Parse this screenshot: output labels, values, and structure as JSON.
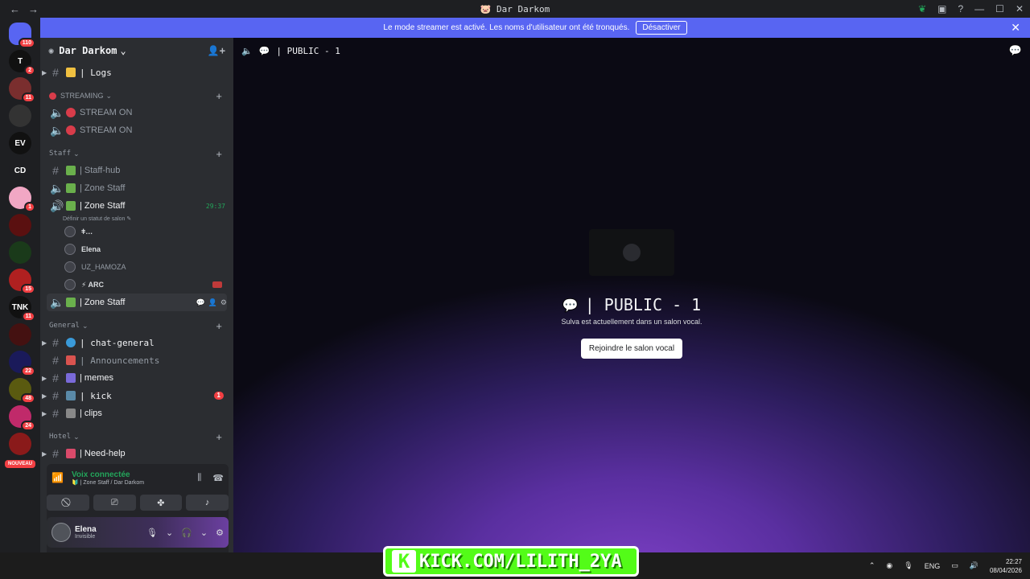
{
  "window": {
    "title": "🐷 Dar Darkom",
    "back": "←",
    "forward": "→"
  },
  "banner": {
    "text": "Le mode streamer est activé. Les noms d'utilisateur ont été tronqués.",
    "button": "Désactiver",
    "close": "✕"
  },
  "guilds": [
    {
      "label": "110",
      "color": "#5865f2",
      "badge": "110",
      "kind": "home"
    },
    {
      "label": "T",
      "color": "#111",
      "badge": "2"
    },
    {
      "label": "",
      "color": "#7a2e2e",
      "badge": "11"
    },
    {
      "label": "",
      "color": "#333",
      "badge": ""
    },
    {
      "label": "EV",
      "color": "#111",
      "badge": ""
    },
    {
      "label": "CD",
      "color": "#1e1f22",
      "badge": ""
    },
    {
      "label": "",
      "color": "#f1a7c4",
      "badge": "1"
    },
    {
      "label": "",
      "color": "#5a1010",
      "badge": ""
    },
    {
      "label": "",
      "color": "#1a3a1a",
      "badge": ""
    },
    {
      "label": "",
      "color": "#b02020",
      "badge": "15"
    },
    {
      "label": "TNK",
      "color": "#111",
      "badge": "11"
    },
    {
      "label": "",
      "color": "#441111",
      "badge": ""
    },
    {
      "label": "",
      "color": "#1a1a5a",
      "badge": "22"
    },
    {
      "label": "",
      "color": "#5a5a10",
      "badge": "48"
    },
    {
      "label": "",
      "color": "#c02a6a",
      "badge": "24"
    },
    {
      "label": "",
      "color": "#8a1a1a",
      "badge": ""
    }
  ],
  "new_badge": "NOUVEAU",
  "server": {
    "name": "Dar Darkom",
    "chevron": "⌄"
  },
  "channels": {
    "logs": "| Logs",
    "streaming_cat": "STREAMING",
    "stream1": "STREAM ON",
    "stream2": "STREAM ON",
    "staff_cat": "Staff",
    "staff_hub": "| Staff-hub",
    "zone_staff_1": "| Zone Staff",
    "zone_staff_active": "| Zone Staff",
    "zone_staff_timer": "29:37",
    "status_hint": "Définir un statut de salon ✎",
    "voice_users": [
      "ǂ…",
      "Elena",
      "UZ_HAMOZA",
      "⚡ ARC"
    ],
    "zone_staff_3": "| Zone Staff",
    "general_cat": "General",
    "chat_general": "| chat-general",
    "announcements": "| Announcements",
    "memes": "| memes",
    "kick": "| kick",
    "kick_badge": "1",
    "clips": "| clips",
    "hotel_cat": "Hotel",
    "need_help": "| Need-help"
  },
  "voice_panel": {
    "status": "Voix connectée",
    "location": "🔰 | Zone Staff / Dar Darkom"
  },
  "user": {
    "name": "Elena",
    "status": "Invisible"
  },
  "main": {
    "channel": "| PUBLIC - 1",
    "title": "| PUBLIC - 1",
    "subtitle": "Sulva est actuellement dans un salon vocal.",
    "join": "Rejoindre le salon vocal"
  },
  "taskbar": {
    "kick_text": "KICK.COM/LILITH_2YA",
    "kick_logo": "K",
    "lang": "ENG",
    "time": "22:27",
    "date": "08/04/2026"
  }
}
